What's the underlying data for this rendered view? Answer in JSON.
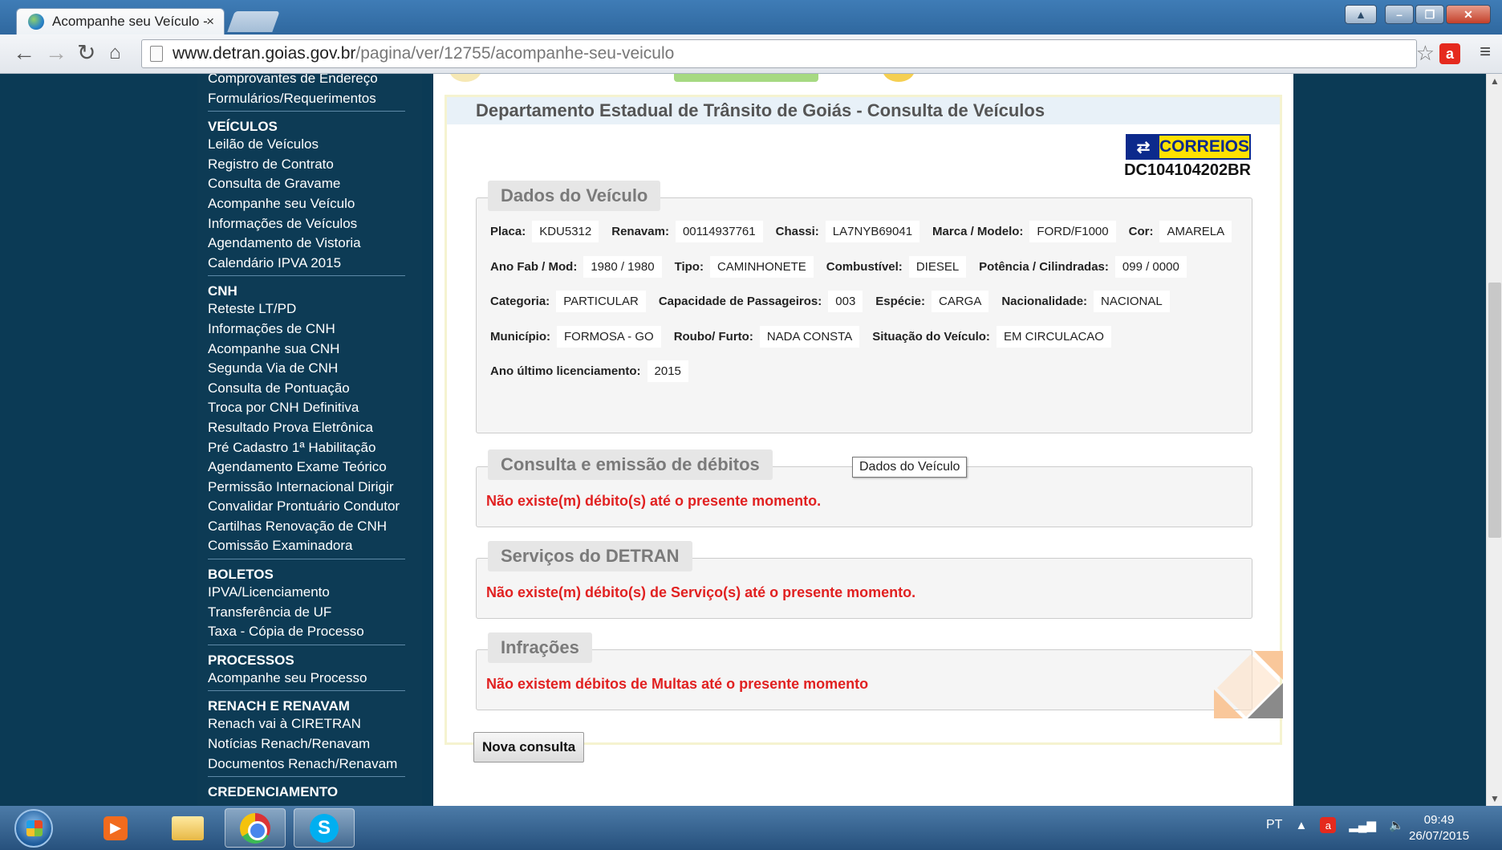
{
  "browser": {
    "tab_title": "Acompanhe seu Veículo -",
    "tab_close": "×",
    "url_host": "www.detran.goias.gov.br",
    "url_path": "/pagina/ver/12755/acompanhe-seu-veiculo"
  },
  "sidebar": {
    "top_items": [
      "Comprovantes de Endereço",
      "Formulários/Requerimentos"
    ],
    "groups": [
      {
        "title": "VEÍCULOS",
        "items": [
          "Leilão de Veículos",
          "Registro de Contrato",
          "Consulta de Gravame",
          "Acompanhe seu Veículo",
          "Informações de Veículos",
          "Agendamento de Vistoria",
          "Calendário IPVA 2015"
        ]
      },
      {
        "title": "CNH",
        "items": [
          "Reteste LT/PD",
          "Informações de CNH",
          "Acompanhe sua CNH",
          "Segunda Via de CNH",
          "Consulta de Pontuação",
          "Troca por CNH Definitiva",
          "Resultado Prova Eletrônica",
          "Pré Cadastro 1ª Habilitação",
          "Agendamento Exame Teórico",
          "Permissão Internacional Dirigir",
          "Convalidar Prontuário Condutor",
          "Cartilhas Renovação de CNH",
          "Comissão Examinadora"
        ]
      },
      {
        "title": "BOLETOS",
        "items": [
          "IPVA/Licenciamento",
          "Transferência de UF",
          "Taxa - Cópia de Processo"
        ]
      },
      {
        "title": "PROCESSOS",
        "items": [
          "Acompanhe seu Processo"
        ]
      },
      {
        "title": "RENACH E RENAVAM",
        "items": [
          "Renach vai à CIRETRAN",
          "Notícias Renach/Renavam",
          "Documentos Renach/Renavam"
        ]
      },
      {
        "title": "CREDENCIAMENTO",
        "items": []
      }
    ]
  },
  "main": {
    "title": "Departamento Estadual de Trânsito de Goiás - Consulta de Veículos",
    "correios_logo": "CORREIOS",
    "tracking_code": "DC104104202BR",
    "vehicle_section": {
      "legend": "Dados do Veículo",
      "rows": [
        [
          {
            "label": "Placa:",
            "value": "KDU5312"
          },
          {
            "label": "Renavam:",
            "value": "00114937761"
          },
          {
            "label": "Chassi:",
            "value": "LA7NYB69041"
          },
          {
            "label": "Marca / Modelo:",
            "value": "FORD/F1000"
          },
          {
            "label": "Cor:",
            "value": "AMARELA"
          }
        ],
        [
          {
            "label": "Ano Fab / Mod:",
            "value": "1980 / 1980"
          },
          {
            "label": "Tipo:",
            "value": "CAMINHONETE"
          },
          {
            "label": "Combustível:",
            "value": "DIESEL"
          },
          {
            "label": "Potência / Cilindradas:",
            "value": "099 / 0000"
          }
        ],
        [
          {
            "label": "Categoria:",
            "value": "PARTICULAR"
          },
          {
            "label": "Capacidade de Passageiros:",
            "value": "003"
          },
          {
            "label": "Espécie:",
            "value": "CARGA"
          },
          {
            "label": "Nacionalidade:",
            "value": "NACIONAL"
          }
        ],
        [
          {
            "label": "Município:",
            "value": "FORMOSA - GO"
          },
          {
            "label": "Roubo/ Furto:",
            "value": "NADA CONSTA"
          },
          {
            "label": "Situação do Veículo:",
            "value": "EM CIRCULACAO"
          }
        ],
        [
          {
            "label": "Ano último licenciamento:",
            "value": "2015"
          }
        ]
      ]
    },
    "debts_section": {
      "legend": "Consulta e emissão de débitos",
      "message": "Não existe(m) débito(s) até o presente momento."
    },
    "services_section": {
      "legend": "Serviços do DETRAN",
      "message": "Não existe(m) débito(s) de Serviço(s) até o presente momento."
    },
    "infractions_section": {
      "legend": "Infrações",
      "message": "Não existem débitos de Multas até o presente momento"
    },
    "tooltip": "Dados do Veículo",
    "new_query_button": "Nova consulta"
  },
  "taskbar": {
    "language": "PT",
    "time": "09:49",
    "date": "26/07/2015"
  }
}
